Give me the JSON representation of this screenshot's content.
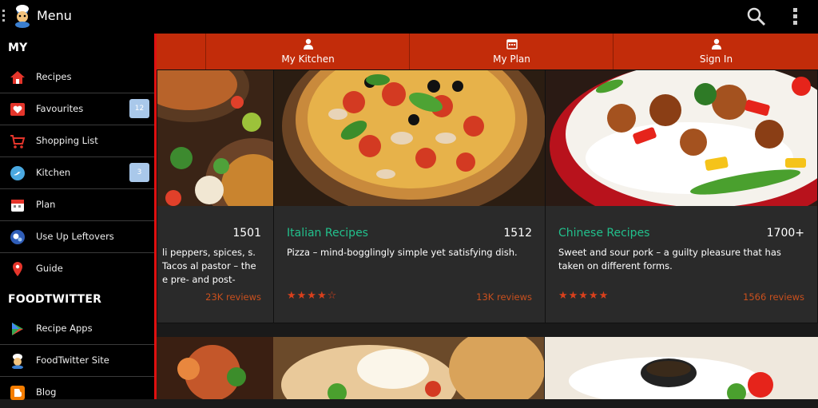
{
  "header": {
    "title": "Menu",
    "app_icon": "chef-mascot-icon",
    "search_icon": "search-icon",
    "overflow_icon": "overflow-menu-icon"
  },
  "sidebar": {
    "sections": [
      {
        "title": "MY",
        "items": [
          {
            "label": "Recipes",
            "icon": "home-icon"
          },
          {
            "label": "Favourites",
            "icon": "heart-icon",
            "badge": "12"
          },
          {
            "label": "Shopping List",
            "icon": "cart-icon"
          },
          {
            "label": "Kitchen",
            "icon": "bird-icon",
            "badge": "3"
          },
          {
            "label": "Plan",
            "icon": "calendar-icon"
          },
          {
            "label": "Use Up Leftovers",
            "icon": "leftovers-icon"
          },
          {
            "label": "Guide",
            "icon": "map-pin-icon"
          }
        ]
      },
      {
        "title": "FOODTWITTER",
        "items": [
          {
            "label": "Recipe Apps",
            "icon": "play-store-icon"
          },
          {
            "label": "FoodTwitter Site",
            "icon": "chef-icon"
          },
          {
            "label": "Blog",
            "icon": "blogger-icon"
          }
        ]
      }
    ]
  },
  "tabs": [
    {
      "label": "",
      "icon": ""
    },
    {
      "label": "My Kitchen",
      "icon": "user-icon"
    },
    {
      "label": "My Plan",
      "icon": "calendar-icon"
    },
    {
      "label": "Sign In",
      "icon": "user-icon"
    }
  ],
  "cards": [
    {
      "name": "",
      "count": "1501",
      "desc": "li peppers, spices, s. Tacos al pastor – the e pre- and post-",
      "stars": "",
      "reviews": "23K reviews"
    },
    {
      "name": "Italian Recipes",
      "count": "1512",
      "desc": "Pizza – mind-bogglingly simple yet satisfying dish.",
      "stars": "★★★★☆",
      "reviews": "13K reviews"
    },
    {
      "name": "Chinese Recipes",
      "count": "1700+",
      "desc": "Sweet and sour pork – a guilty pleasure that has taken on different forms.",
      "stars": "★★★★★",
      "reviews": "1566 reviews"
    }
  ],
  "colors": {
    "accent": "#c22c0a",
    "recipe_name": "#22c08c",
    "star": "#d8401c",
    "badge": "#a9c8ea"
  }
}
